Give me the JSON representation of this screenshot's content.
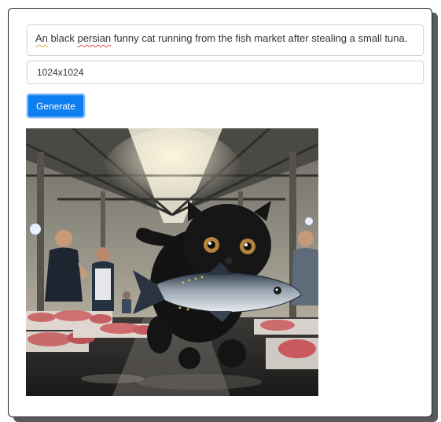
{
  "form": {
    "prompt_words": {
      "w1": "An",
      "w2": "black",
      "w3": "persian",
      "w4": "funny cat running from the fish market after stealing a small tuna."
    },
    "size_value": "1024x1024",
    "generate_label": "Generate"
  },
  "image": {
    "subject": "black persian cat running through fish market with tuna in mouth"
  },
  "colors": {
    "button": "#0d7ef0",
    "border": "#cfd4da",
    "shadow": "#5a5a5a"
  }
}
